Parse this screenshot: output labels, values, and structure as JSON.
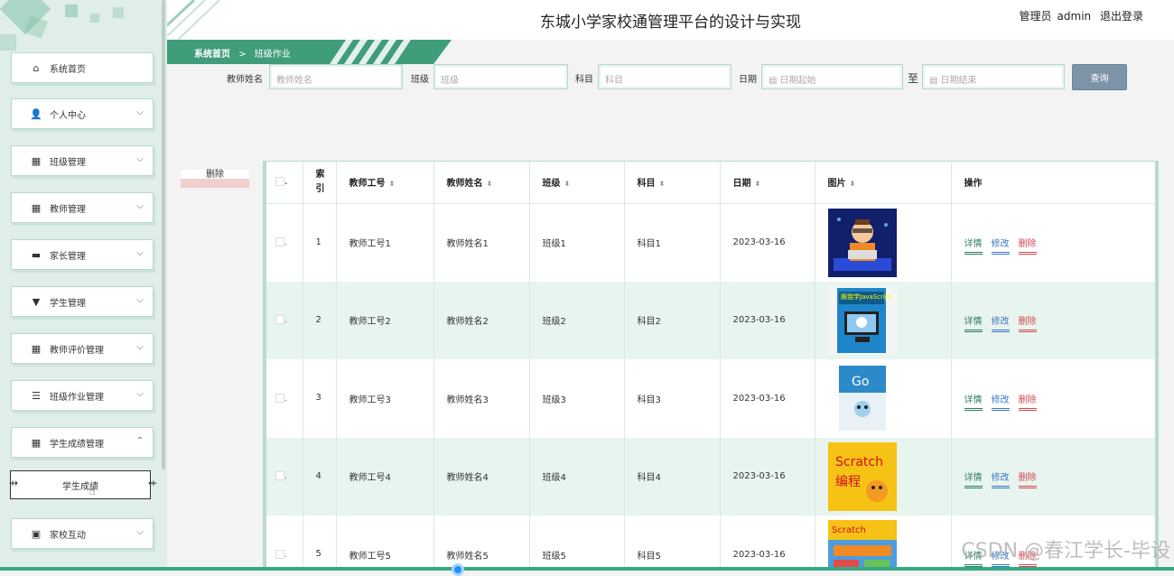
{
  "header": {
    "title": "东城小学家校通管理平台的设计与实现",
    "user_role": "管理员",
    "user_name": "admin",
    "logout": "退出登录"
  },
  "breadcrumb": {
    "home": "系统首页",
    "sep": ">",
    "current": "班级作业"
  },
  "sidebar": {
    "items": [
      {
        "label": "系统首页",
        "icon": "home-icon",
        "glyph": "⌂",
        "arrow": ""
      },
      {
        "label": "个人中心",
        "icon": "user-icon",
        "glyph": "👤",
        "arrow": "⌵"
      },
      {
        "label": "班级管理",
        "icon": "grid-icon",
        "glyph": "▦",
        "arrow": "⌵"
      },
      {
        "label": "教师管理",
        "icon": "grid-icon",
        "glyph": "▦",
        "arrow": "⌵"
      },
      {
        "label": "家长管理",
        "icon": "chat-icon",
        "glyph": "▬",
        "arrow": "⌵"
      },
      {
        "label": "学生管理",
        "icon": "flag-icon",
        "glyph": "▼",
        "arrow": "⌵"
      },
      {
        "label": "教师评价管理",
        "icon": "grid-icon",
        "glyph": "▦",
        "arrow": "⌵"
      },
      {
        "label": "班级作业管理",
        "icon": "list-icon",
        "glyph": "☰",
        "arrow": "⌵"
      },
      {
        "label": "学生成绩管理",
        "icon": "grid-icon",
        "glyph": "▦",
        "arrow": "⌃"
      },
      {
        "label": "家校互动",
        "icon": "clipboard-icon",
        "glyph": "▣",
        "arrow": "⌵"
      }
    ],
    "sub_item": "学生成绩"
  },
  "search": {
    "teacher_name_label": "教师姓名",
    "teacher_name_placeholder": "教师姓名",
    "class_label": "班级",
    "class_placeholder": "班级",
    "subject_label": "科目",
    "subject_placeholder": "科目",
    "date_label": "日期",
    "date_start_placeholder": "日期起始",
    "to_label": "至",
    "date_end_placeholder": "日期结束",
    "query_button": "查询"
  },
  "actions": {
    "delete": "删除"
  },
  "table": {
    "headers": {
      "index": "索引",
      "teacher_id": "教师工号",
      "teacher_name": "教师姓名",
      "class": "班级",
      "subject": "科目",
      "date": "日期",
      "image": "图片",
      "ops": "操作"
    },
    "op_labels": {
      "detail": "详情",
      "edit": "修改",
      "delete": "删除"
    },
    "rows": [
      {
        "index": "1",
        "teacher_id": "教师工号1",
        "teacher_name": "教师姓名1",
        "class": "班级1",
        "subject": "科目1",
        "date": "2023-03-16",
        "image": "cartoon-programmer"
      },
      {
        "index": "2",
        "teacher_id": "教师工号2",
        "teacher_name": "教师姓名2",
        "class": "班级2",
        "subject": "科目2",
        "date": "2023-03-16",
        "image": "book-javascript"
      },
      {
        "index": "3",
        "teacher_id": "教师工号3",
        "teacher_name": "教师姓名3",
        "class": "班级3",
        "subject": "科目3",
        "date": "2023-03-16",
        "image": "book-go"
      },
      {
        "index": "4",
        "teacher_id": "教师工号4",
        "teacher_name": "教师姓名4",
        "class": "班级4",
        "subject": "科目4",
        "date": "2023-03-16",
        "image": "book-scratch"
      },
      {
        "index": "5",
        "teacher_id": "教师工号5",
        "teacher_name": "教师姓名5",
        "class": "班级5",
        "subject": "科目5",
        "date": "2023-03-16",
        "image": "book-scratch-kids"
      }
    ]
  },
  "watermark": "CSDN @春江学长-毕设",
  "colors": {
    "accent": "#35a985",
    "sidebar_bg": "#dfeee8",
    "query_btn": "#7d93a8",
    "delete_link": "#d2484f",
    "edit_link": "#3b78c4",
    "detail_link": "#2e7d5b"
  }
}
